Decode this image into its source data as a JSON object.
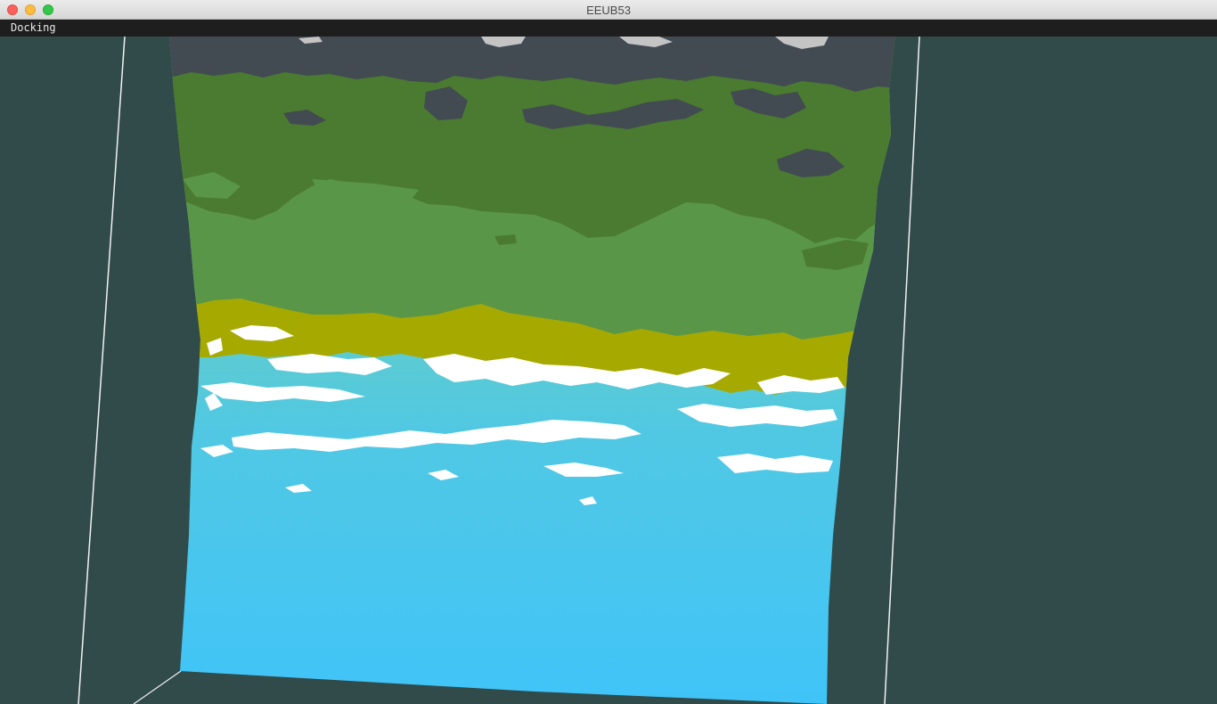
{
  "window": {
    "title": "EEUB53",
    "controls": {
      "close": "close",
      "minimize": "minimize",
      "zoom": "zoom"
    }
  },
  "menubar": {
    "items": [
      {
        "label": "Docking"
      }
    ]
  },
  "scene": {
    "background_color": "#314a4a",
    "frame_line_color": "#f2f2f2",
    "terrain_colors": {
      "rock": "#424a52",
      "snow": "#c4c4c4",
      "dark_forest": "#4a7b30",
      "forest": "#5a9648",
      "sand": "#a6aa00",
      "foam": "#ffffff",
      "shallow_water": "#7ad0a8",
      "deep_water": "#42c6f6"
    }
  }
}
